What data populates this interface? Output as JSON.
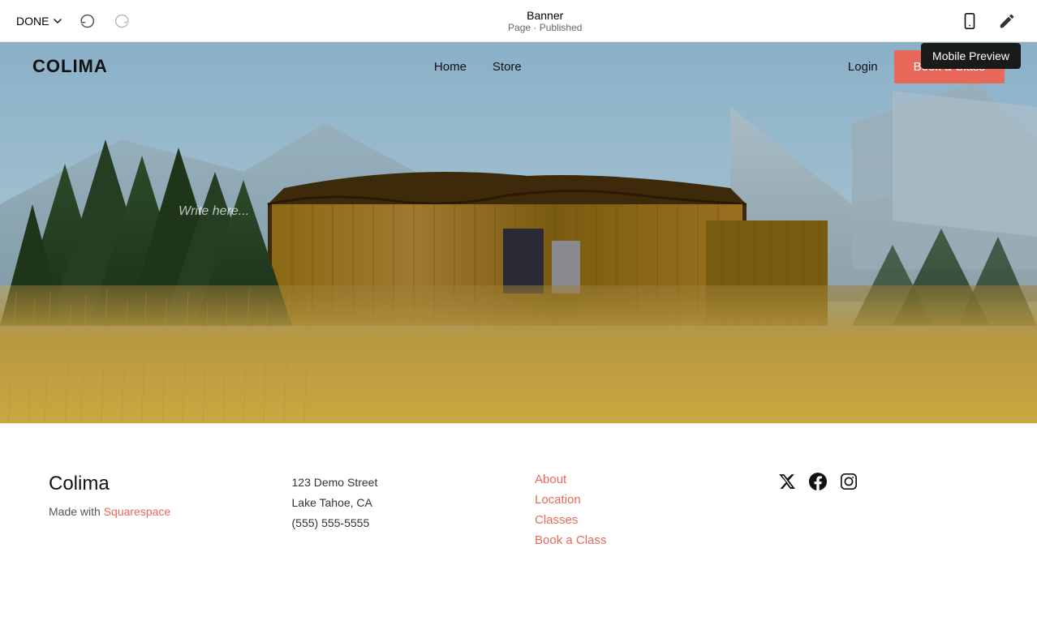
{
  "topBar": {
    "done_label": "DONE",
    "page_name": "Banner",
    "page_status": "Page · Published",
    "mobile_preview_tooltip": "Mobile Preview"
  },
  "siteHeader": {
    "logo": "COLIMA",
    "nav": [
      {
        "label": "Home",
        "href": "#"
      },
      {
        "label": "Store",
        "href": "#"
      }
    ],
    "login_label": "Login",
    "book_label": "Book a Class"
  },
  "hero": {
    "placeholder_text": "Write here..."
  },
  "footer": {
    "brand_name": "Colima",
    "made_with_prefix": "Made with ",
    "squarespace_label": "Squarespace",
    "address_line1": "123 Demo Street",
    "address_line2": "Lake Tahoe, CA",
    "phone": "(555) 555-5555",
    "links": [
      {
        "label": "About",
        "href": "#"
      },
      {
        "label": "Location",
        "href": "#"
      },
      {
        "label": "Classes",
        "href": "#"
      },
      {
        "label": "Book a Class",
        "href": "#"
      }
    ],
    "social": [
      {
        "name": "twitter",
        "symbol": "𝕏"
      },
      {
        "name": "facebook",
        "symbol": "f"
      },
      {
        "name": "instagram",
        "symbol": "◻"
      }
    ]
  },
  "colors": {
    "accent": "#e8695a",
    "logo": "#111111",
    "tooltip_bg": "#1a1a1a"
  }
}
